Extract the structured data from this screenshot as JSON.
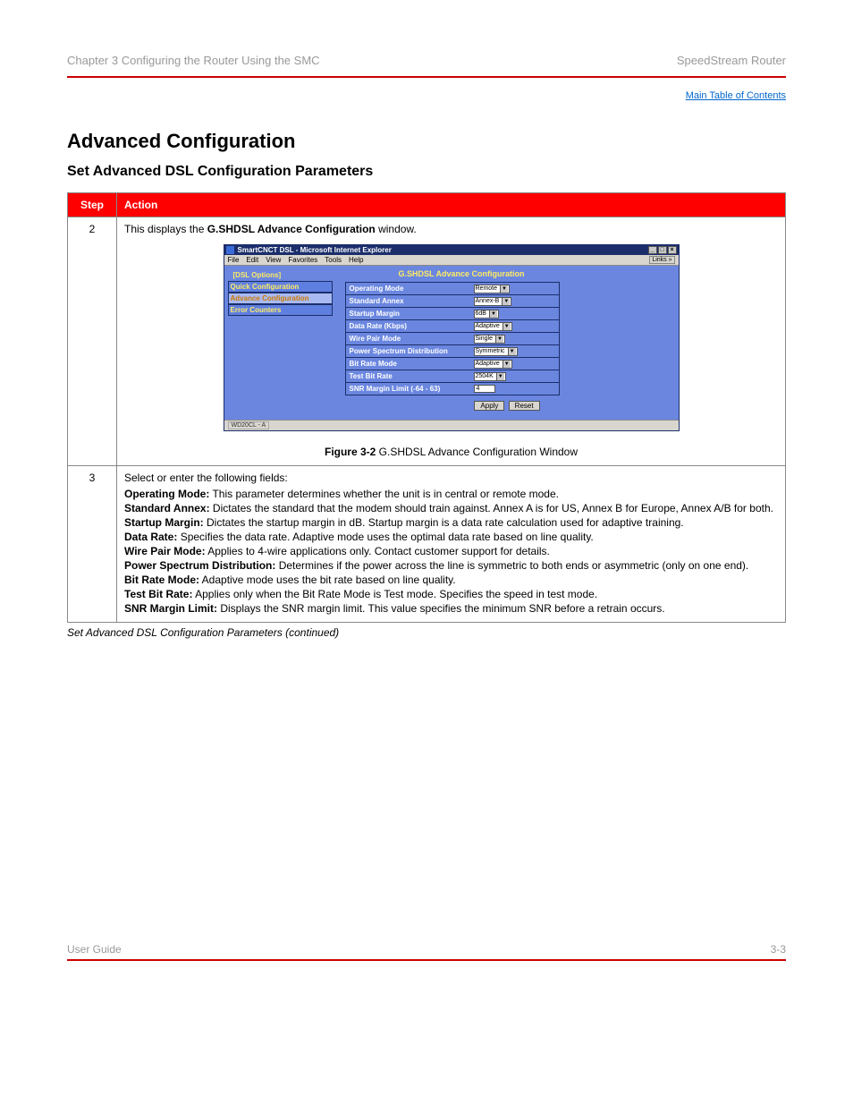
{
  "header": {
    "left": "Chapter 3    Configuring the Router Using the SMC",
    "right": "SpeedStream Router"
  },
  "toc_link": "Main Table of Contents",
  "title_main": "Advanced Configuration",
  "title_sub": "Set Advanced DSL Configuration Parameters",
  "title_sub2": "Set Advanced DSL Configuration Parameters (continued)",
  "tbl_header": {
    "step": "Step",
    "action": "Action"
  },
  "row1": {
    "step": "2",
    "lead1": "This displays the ",
    "bold": "G.SHDSL Advance Configuration",
    "lead2": " window.",
    "figcap_b": "Figure 3-2",
    "figcap_t": "    G.SHDSL Advance Configuration Window"
  },
  "row2": {
    "step": "3",
    "lead": "Select or enter the following fields:",
    "items": [
      {
        "lab": "Operating Mode:",
        "txt": " This parameter determines whether the unit is in central or remote mode."
      },
      {
        "lab": "Standard Annex:",
        "txt": " Dictates the standard that the modem should train against. Annex A is for US, Annex B for Europe, Annex A/B for both."
      },
      {
        "lab": "Startup Margin:",
        "txt": " Dictates the startup margin in dB. Startup margin is a data rate calculation used for adaptive training."
      },
      {
        "lab": "Data Rate:",
        "txt": " Specifies the data rate. Adaptive mode uses the optimal data rate based on line quality."
      },
      {
        "lab": "Wire Pair Mode:",
        "txt": " Applies to 4-wire applications only. Contact customer support for details."
      },
      {
        "lab": "Power Spectrum Distribution:",
        "txt": " Determines if the power across the line is symmetric to both ends or asymmetric (only on one end)."
      },
      {
        "lab": "Bit Rate Mode:",
        "txt": " Adaptive mode uses the bit rate based on line quality."
      },
      {
        "lab": "Test Bit Rate:",
        "txt": " Applies only when the Bit Rate Mode is Test mode. Specifies the speed in test mode."
      },
      {
        "lab": "SNR Margin Limit:",
        "txt": " Displays the SNR margin limit. This value specifies the minimum SNR before a retrain occurs."
      }
    ]
  },
  "ie": {
    "title": "SmartCNCT DSL - Microsoft Internet Explorer",
    "menu": [
      "File",
      "Edit",
      "View",
      "Favorites",
      "Tools",
      "Help"
    ],
    "links": "Links »",
    "sidebar_title": "[DSL Options]",
    "sidebar": [
      {
        "label": "Quick Configuration",
        "active": false
      },
      {
        "label": "Advance Configuration",
        "active": true
      },
      {
        "label": "Error Counters",
        "active": false
      }
    ],
    "cfg_title": "G.SHDSL Advance Configuration",
    "rows": [
      {
        "label": "Operating Mode",
        "val": "Remote",
        "type": "select"
      },
      {
        "label": "Standard Annex",
        "val": "Annex-B",
        "type": "select"
      },
      {
        "label": "Startup Margin",
        "val": "6dB",
        "type": "select"
      },
      {
        "label": "Data Rate (Kbps)",
        "val": "Adaptive",
        "type": "select"
      },
      {
        "label": "Wire Pair Mode",
        "val": "Single",
        "type": "select"
      },
      {
        "label": "Power Spectrum Distribution",
        "val": "Symmetric",
        "type": "select"
      },
      {
        "label": "Bit Rate Mode",
        "val": "Adaptive",
        "type": "select"
      },
      {
        "label": "Test Bit Rate",
        "val": "2504K",
        "type": "select"
      },
      {
        "label": "SNR Margin Limit (-64 - 63)",
        "val": "4",
        "type": "input"
      }
    ],
    "apply": "Apply",
    "reset": "Reset",
    "status": "WD20CL - A"
  },
  "footer": {
    "left": "User Guide",
    "right": "3-3"
  }
}
